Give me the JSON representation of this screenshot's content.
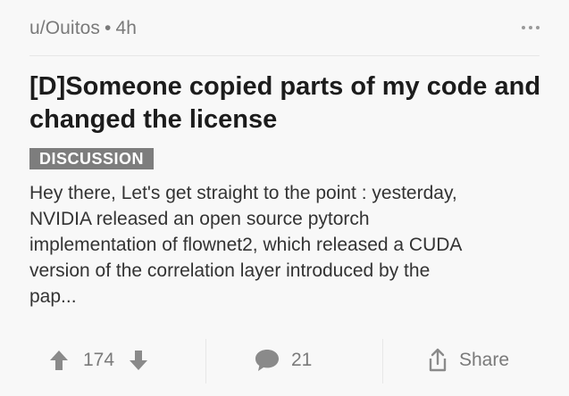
{
  "post": {
    "author": "u/Ouitos",
    "separator": "•",
    "age": "4h",
    "title": "[D]Someone copied parts of my code and changed the license",
    "flair": "DISCUSSION",
    "body": "Hey there,  Let's get straight to the point : yesterday,\nNVIDIA released an open source pytorch\nimplementation of flownet2, which released a CUDA\nversion of the correlation layer introduced by the\npap..."
  },
  "actions": {
    "score": "174",
    "comment_count": "21",
    "share_label": "Share"
  },
  "icons": {
    "more": "more-horizontal-icon",
    "upvote": "upvote-arrow-icon",
    "downvote": "downvote-arrow-icon",
    "comment": "comment-bubble-icon",
    "share": "share-icon"
  },
  "colors": {
    "background": "#f8f8f8",
    "text": "#1c1c1c",
    "muted": "#7a7a7a",
    "flair_bg": "#7d7d7d"
  }
}
